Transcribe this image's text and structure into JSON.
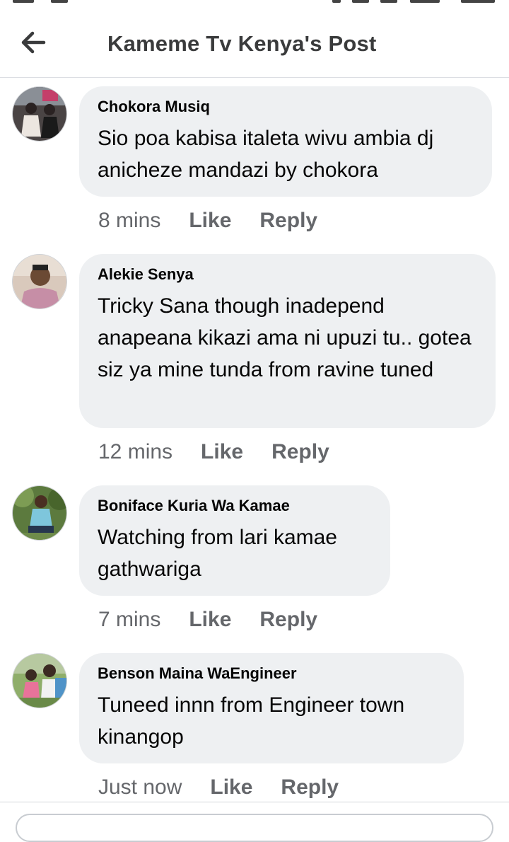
{
  "header": {
    "title": "Kameme Tv Kenya's Post",
    "back_icon": "arrow-left-icon"
  },
  "comments": [
    {
      "author": "Chokora Musiq",
      "text": "Sio poa kabisa italeta wivu ambia dj anicheze mandazi by chokora",
      "time": "8 mins",
      "like_label": "Like",
      "reply_label": "Reply"
    },
    {
      "author": "Alekie Senya",
      "text": "Tricky Sana though inadepend anapeana kikazi ama ni upuzi tu.. gotea siz ya mine tunda from ravine tuned",
      "time": "12 mins",
      "like_label": "Like",
      "reply_label": "Reply"
    },
    {
      "author": "Boniface Kuria Wa Kamae",
      "text": "Watching from lari kamae gathwariga",
      "time": "7 mins",
      "like_label": "Like",
      "reply_label": "Reply"
    },
    {
      "author": "Benson Maina WaEngineer",
      "text": "Tuneed innn from Engineer town kinangop",
      "time": "Just now",
      "like_label": "Like",
      "reply_label": "Reply"
    }
  ],
  "colors": {
    "bubble": "#eef0f2",
    "secondary_text": "#65676b",
    "primary_text": "#050505"
  }
}
